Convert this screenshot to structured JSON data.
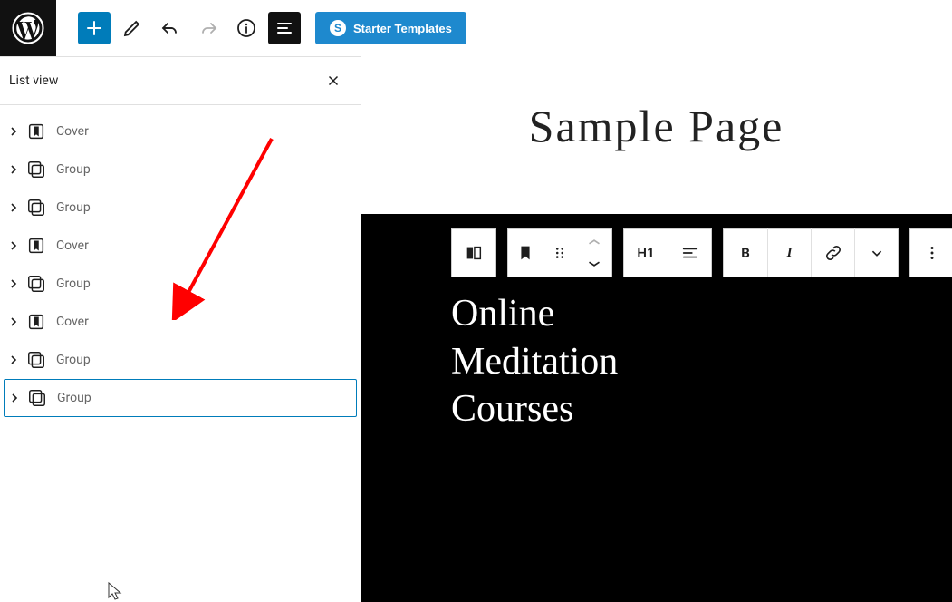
{
  "toolbar": {
    "starter_label": "Starter Templates",
    "starter_icon": "S"
  },
  "listview": {
    "title": "List view",
    "items": [
      {
        "label": "Cover",
        "type": "cover",
        "selected": false
      },
      {
        "label": "Group",
        "type": "group",
        "selected": false
      },
      {
        "label": "Group",
        "type": "group",
        "selected": false
      },
      {
        "label": "Cover",
        "type": "cover",
        "selected": false
      },
      {
        "label": "Group",
        "type": "group",
        "selected": false
      },
      {
        "label": "Cover",
        "type": "cover",
        "selected": false
      },
      {
        "label": "Group",
        "type": "group",
        "selected": false
      },
      {
        "label": "Group",
        "type": "group",
        "selected": true
      }
    ]
  },
  "canvas": {
    "page_title": "Sample Page",
    "heading_text": "Online\nMeditation\nCourses",
    "block_toolbar": {
      "heading_level": "H1",
      "bold": "B",
      "italic": "I"
    }
  },
  "colors": {
    "accent": "#007cba",
    "starter_blue": "#1e89ce",
    "black": "#000000"
  }
}
